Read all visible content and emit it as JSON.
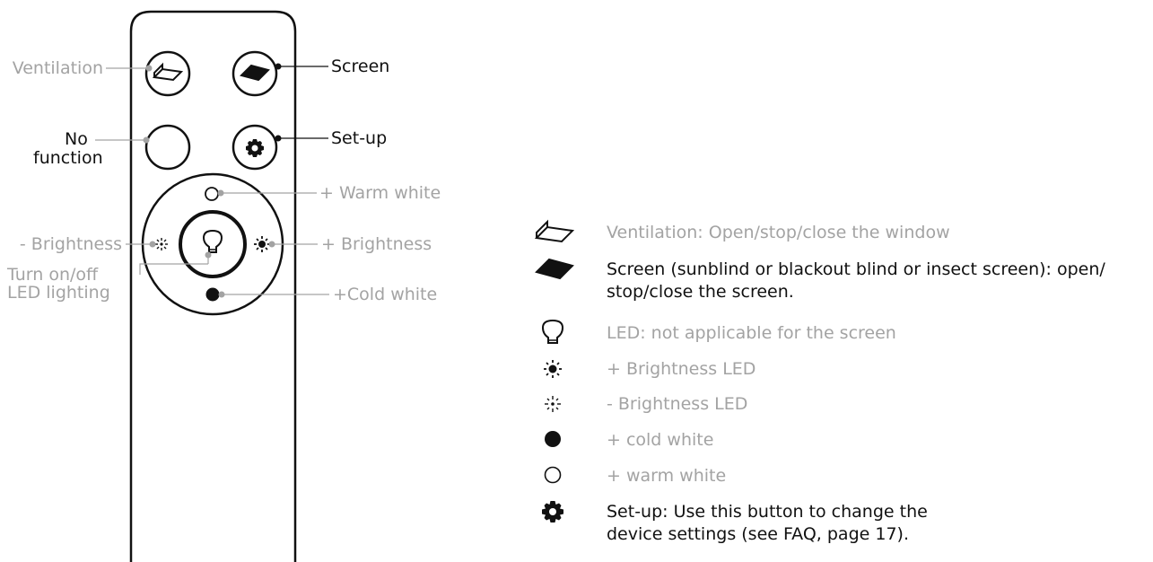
{
  "remote": {
    "labels": {
      "ventilation": "Ventilation",
      "screen": "Screen",
      "no_function_line1": "No",
      "no_function_line2": "function",
      "setup": "Set-up",
      "warm_white": "+ Warm white",
      "minus_brightness": "- Brightness",
      "plus_brightness": "+ Brightness",
      "turn_on_off_line1": "Turn on/off",
      "turn_on_off_line2": "LED lighting",
      "cold_white": "+Cold white"
    }
  },
  "legend": {
    "items": [
      {
        "icon": "ventilation-icon",
        "text": "Ventilation: Open/stop/close the window",
        "color": "#a3a3a3"
      },
      {
        "icon": "screen-icon",
        "text_line1": "Screen (sunblind or blackout blind or insect screen): open/",
        "text_line2": "stop/close the screen.",
        "color": "#111111"
      },
      {
        "icon": "bulb-icon",
        "text": "LED: not applicable for the screen",
        "color": "#a3a3a3"
      },
      {
        "icon": "plus-brightness-icon",
        "text": "+ Brightness LED",
        "color": "#a3a3a3"
      },
      {
        "icon": "minus-brightness-icon",
        "text": "- Brightness LED",
        "color": "#a3a3a3"
      },
      {
        "icon": "filled-circle-icon",
        "text": "+ cold white",
        "color": "#a3a3a3"
      },
      {
        "icon": "empty-circle-icon",
        "text": "+ warm white",
        "color": "#a3a3a3"
      },
      {
        "icon": "gear-icon",
        "text_line1": "Set-up: Use this button to change the",
        "text_line2": "device settings (see FAQ, page 17).",
        "color": "#111111"
      }
    ]
  },
  "colors": {
    "gray": "#a3a3a3",
    "black": "#111111"
  }
}
